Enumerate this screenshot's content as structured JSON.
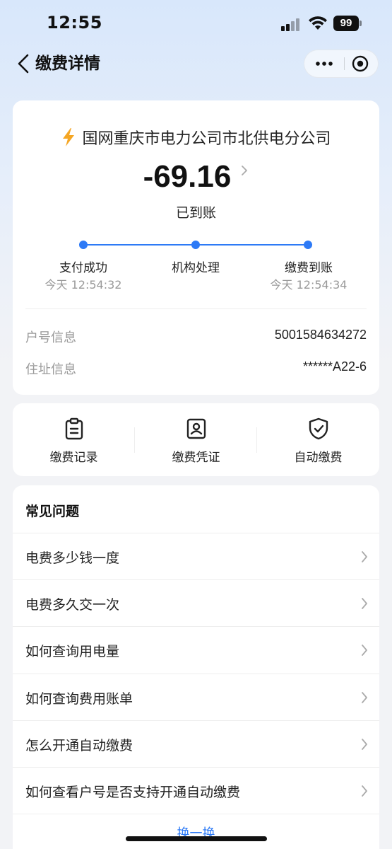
{
  "status_bar": {
    "time": "12:55",
    "battery": "99"
  },
  "nav": {
    "title": "缴费详情"
  },
  "payment": {
    "payee": "国网重庆市电力公司市北供电分公司",
    "amount": "-69.16",
    "status": "已到账",
    "steps": [
      {
        "label": "支付成功",
        "time": "今天 12:54:32"
      },
      {
        "label": "机构处理",
        "time": ""
      },
      {
        "label": "缴费到账",
        "time": "今天 12:54:34"
      }
    ],
    "info": [
      {
        "label": "户号信息",
        "value": "5001584634272"
      },
      {
        "label": "住址信息",
        "value": "******A22-6"
      }
    ]
  },
  "actions": [
    {
      "label": "缴费记录",
      "icon": "clipboard-icon"
    },
    {
      "label": "缴费凭证",
      "icon": "receipt-icon"
    },
    {
      "label": "自动缴费",
      "icon": "shield-check-icon"
    }
  ],
  "faq": {
    "title": "常见问题",
    "items": [
      "电费多少钱一度",
      "电费多久交一次",
      "如何查询用电量",
      "如何查询费用账单",
      "怎么开通自动缴费",
      "如何查看户号是否支持开通自动缴费"
    ],
    "swap_label": "换一换"
  },
  "colors": {
    "accent": "#2d7af6",
    "bolt": "#f5a623"
  }
}
